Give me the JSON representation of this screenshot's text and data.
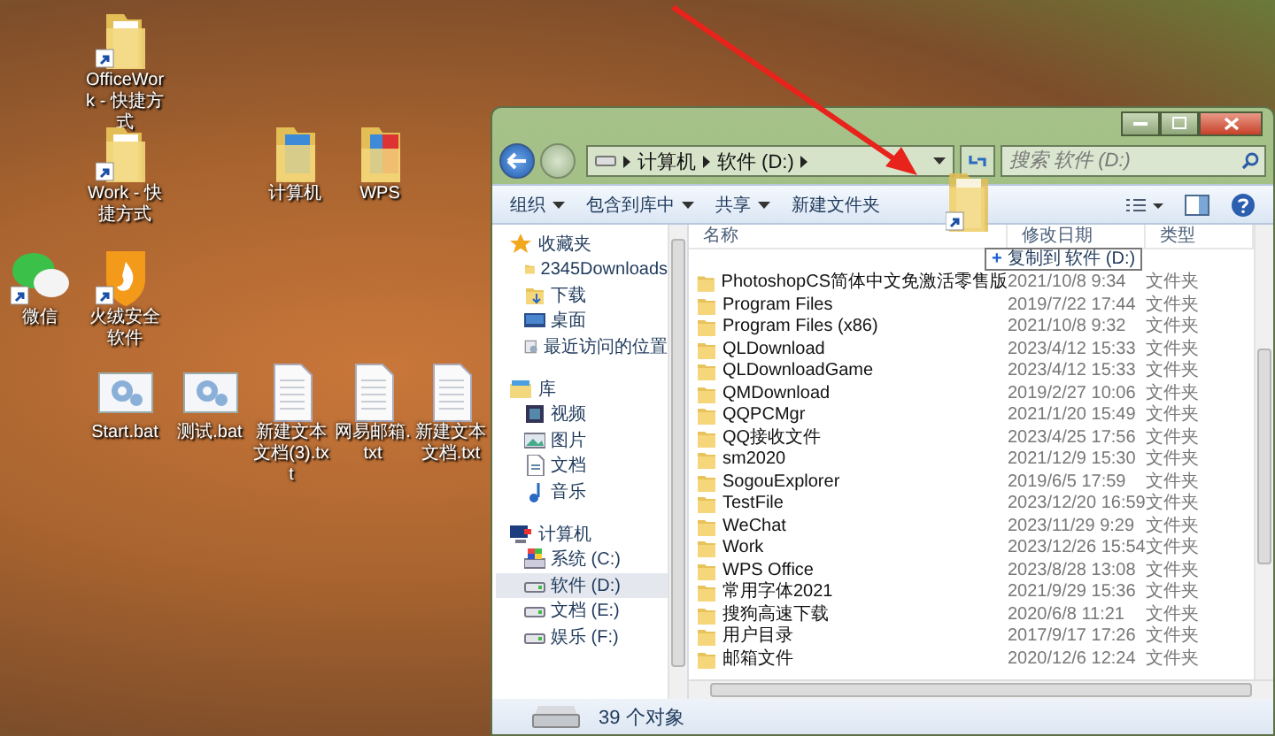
{
  "desktop": {
    "icons": [
      {
        "label": "OfficeWork - 快捷方式",
        "kind": "folder-shortcut"
      },
      {
        "label": "Work - 快捷方式",
        "kind": "folder-shortcut"
      },
      {
        "label": "计算机",
        "kind": "folder-blue"
      },
      {
        "label": "WPS",
        "kind": "folder-red"
      },
      {
        "label": "微信",
        "kind": "chat-shortcut"
      },
      {
        "label": "火绒安全软件",
        "kind": "shield-shortcut"
      },
      {
        "label": "Start.bat",
        "kind": "bat"
      },
      {
        "label": "测试.bat",
        "kind": "bat"
      },
      {
        "label": "新建文本文档(3).txt",
        "kind": "txt"
      },
      {
        "label": "网易邮箱.txt",
        "kind": "txt"
      },
      {
        "label": "新建文本文档.txt",
        "kind": "txt"
      }
    ]
  },
  "explorer": {
    "breadcrumb": [
      "计算机",
      "软件 (D:)"
    ],
    "search": {
      "placeholder": "搜索 软件 (D:)"
    },
    "toolbar": [
      {
        "label": "组织",
        "dropdown": true
      },
      {
        "label": "包含到库中",
        "dropdown": true
      },
      {
        "label": "共享",
        "dropdown": true
      },
      {
        "label": "新建文件夹",
        "dropdown": false
      }
    ],
    "sidebar": [
      {
        "label": "收藏夹",
        "kind": "star",
        "children": [
          {
            "label": "2345Downloads",
            "kind": "folder",
            "selected": false
          },
          {
            "label": "下载",
            "kind": "download",
            "selected": false
          },
          {
            "label": "桌面",
            "kind": "desktop",
            "selected": false
          },
          {
            "label": "最近访问的位置",
            "kind": "recent",
            "selected": false
          }
        ]
      },
      {
        "label": "库",
        "kind": "library",
        "children": [
          {
            "label": "视频",
            "kind": "video",
            "selected": false
          },
          {
            "label": "图片",
            "kind": "picture",
            "selected": false
          },
          {
            "label": "文档",
            "kind": "document",
            "selected": false
          },
          {
            "label": "音乐",
            "kind": "music",
            "selected": false
          }
        ]
      },
      {
        "label": "计算机",
        "kind": "computer",
        "children": [
          {
            "label": "系统 (C:)",
            "kind": "system-drive",
            "selected": false
          },
          {
            "label": "软件 (D:)",
            "kind": "drive",
            "selected": true
          },
          {
            "label": "文档 (E:)",
            "kind": "drive",
            "selected": false
          },
          {
            "label": "娱乐 (F:)",
            "kind": "drive",
            "selected": false
          }
        ]
      }
    ],
    "columns": [
      "名称",
      "修改日期",
      "类型"
    ],
    "files": [
      {
        "name": "PhotoshopCS简体中文免激活零售版",
        "modified": "2021/10/8 9:34",
        "type": "文件夹"
      },
      {
        "name": "Program Files",
        "modified": "2019/7/22 17:44",
        "type": "文件夹"
      },
      {
        "name": "Program Files (x86)",
        "modified": "2021/10/8 9:32",
        "type": "文件夹"
      },
      {
        "name": "QLDownload",
        "modified": "2023/4/12 15:33",
        "type": "文件夹"
      },
      {
        "name": "QLDownloadGame",
        "modified": "2023/4/12 15:33",
        "type": "文件夹"
      },
      {
        "name": "QMDownload",
        "modified": "2019/2/27 10:06",
        "type": "文件夹"
      },
      {
        "name": "QQPCMgr",
        "modified": "2021/1/20 15:49",
        "type": "文件夹"
      },
      {
        "name": "QQ接收文件",
        "modified": "2023/4/25 17:56",
        "type": "文件夹"
      },
      {
        "name": "sm2020",
        "modified": "2021/12/9 15:30",
        "type": "文件夹"
      },
      {
        "name": "SogouExplorer",
        "modified": "2019/6/5 17:59",
        "type": "文件夹"
      },
      {
        "name": "TestFile",
        "modified": "2023/12/20 16:59",
        "type": "文件夹"
      },
      {
        "name": "WeChat",
        "modified": "2023/11/29 9:29",
        "type": "文件夹"
      },
      {
        "name": "Work",
        "modified": "2023/12/26 15:54",
        "type": "文件夹"
      },
      {
        "name": "WPS Office",
        "modified": "2023/8/28 13:08",
        "type": "文件夹"
      },
      {
        "name": "常用字体2021",
        "modified": "2021/9/29 15:36",
        "type": "文件夹"
      },
      {
        "name": "搜狗高速下载",
        "modified": "2020/6/8 11:21",
        "type": "文件夹"
      },
      {
        "name": "用户目录",
        "modified": "2017/9/17 17:26",
        "type": "文件夹"
      },
      {
        "name": "邮箱文件",
        "modified": "2020/12/6 12:24",
        "type": "文件夹"
      }
    ],
    "status": "39 个对象",
    "drag_tooltip": {
      "symbol": "+",
      "text": "复制到 软件 (D:)"
    }
  }
}
